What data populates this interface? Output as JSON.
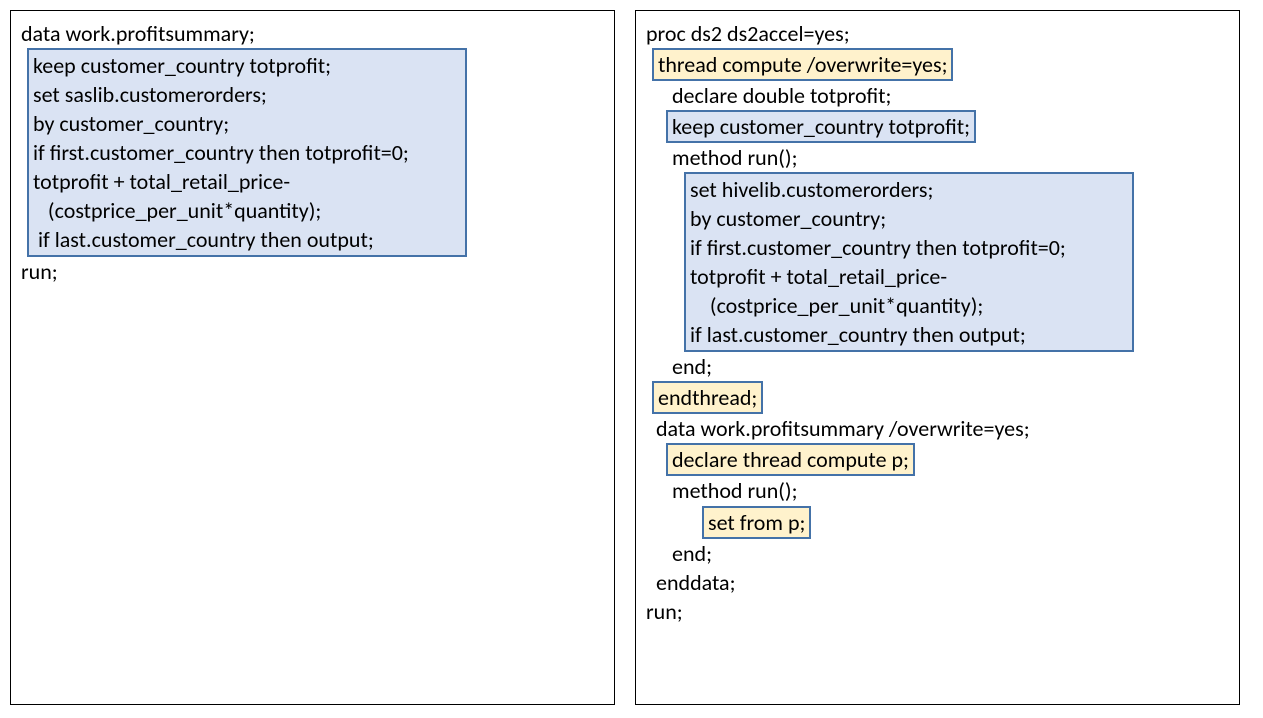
{
  "left": {
    "l1": "data work.profitsummary;",
    "box": {
      "b1": "keep customer_country totprofit;",
      "b2": "set saslib.customerorders;",
      "b3": "by customer_country;",
      "b4": "if first.customer_country then totprofit=0;",
      "b5": "totprofit + total_retail_price-",
      "b6": "   (costprice_per_unit*quantity);",
      "b7": " if last.customer_country then output;"
    },
    "l2": "run;"
  },
  "right": {
    "r1": "proc ds2 ds2accel=yes;",
    "gold1": "thread compute /overwrite=yes;",
    "r2": "declare double totprofit;",
    "blue1": "keep customer_country totprofit;",
    "r3": "method run();",
    "box": {
      "b1": "set hivelib.customerorders;",
      "b2": "by customer_country;",
      "b3": "if first.customer_country then totprofit=0;",
      "b4": "totprofit + total_retail_price-",
      "b5": "    (costprice_per_unit*quantity);",
      "b6": "if last.customer_country then output;"
    },
    "r4": "end;",
    "gold2": "endthread;",
    "r5": "data work.profitsummary /overwrite=yes;",
    "gold3": "declare thread compute p;",
    "r6": "method run();",
    "gold4": "set from p;",
    "r7": "end;",
    "r8": "enddata;",
    "r9": "run;"
  }
}
